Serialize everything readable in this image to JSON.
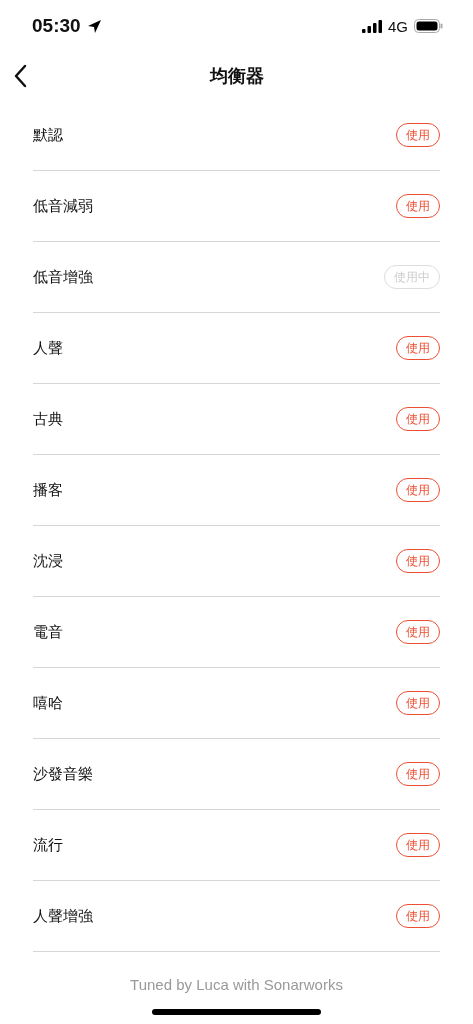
{
  "status_bar": {
    "time": "05:30",
    "network": "4G"
  },
  "nav": {
    "title": "均衡器"
  },
  "presets": [
    {
      "name": "默認",
      "button": "使用",
      "selected": false
    },
    {
      "name": "低音減弱",
      "button": "使用",
      "selected": false
    },
    {
      "name": "低音增強",
      "button": "使用中",
      "selected": true
    },
    {
      "name": "人聲",
      "button": "使用",
      "selected": false
    },
    {
      "name": "古典",
      "button": "使用",
      "selected": false
    },
    {
      "name": "播客",
      "button": "使用",
      "selected": false
    },
    {
      "name": "沈浸",
      "button": "使用",
      "selected": false
    },
    {
      "name": "電音",
      "button": "使用",
      "selected": false
    },
    {
      "name": "嘻哈",
      "button": "使用",
      "selected": false
    },
    {
      "name": "沙發音樂",
      "button": "使用",
      "selected": false
    },
    {
      "name": "流行",
      "button": "使用",
      "selected": false
    },
    {
      "name": "人聲增強",
      "button": "使用",
      "selected": false
    }
  ],
  "footer": "Tuned by Luca with Sonarworks"
}
